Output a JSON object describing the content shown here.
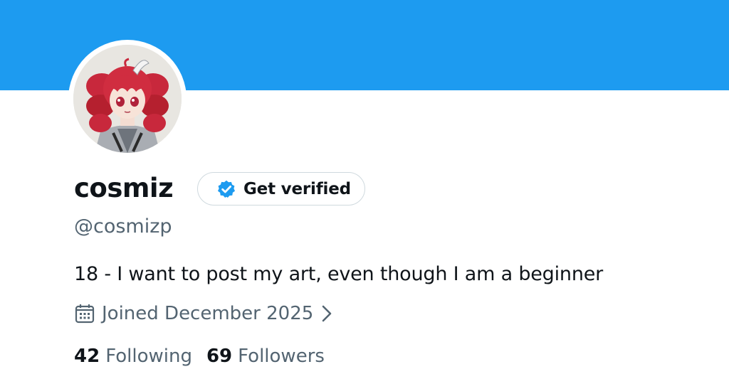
{
  "profile": {
    "display_name": "cosmiz",
    "handle": "@cosmizp",
    "bio": "18 - I want to post my art, even though I am a beginner",
    "joined": "Joined December 2025",
    "verify_button_label": "Get verified",
    "following_count": "42",
    "following_label": "Following",
    "followers_count": "69",
    "followers_label": "Followers"
  },
  "colors": {
    "banner": "#1d9bf0",
    "verified_badge": "#1d9bf0",
    "secondary_text": "#536471",
    "primary_text": "#0f1419"
  },
  "icons": {
    "verified": "verified-badge-icon",
    "calendar": "calendar-icon",
    "chevron": "chevron-right-icon"
  }
}
